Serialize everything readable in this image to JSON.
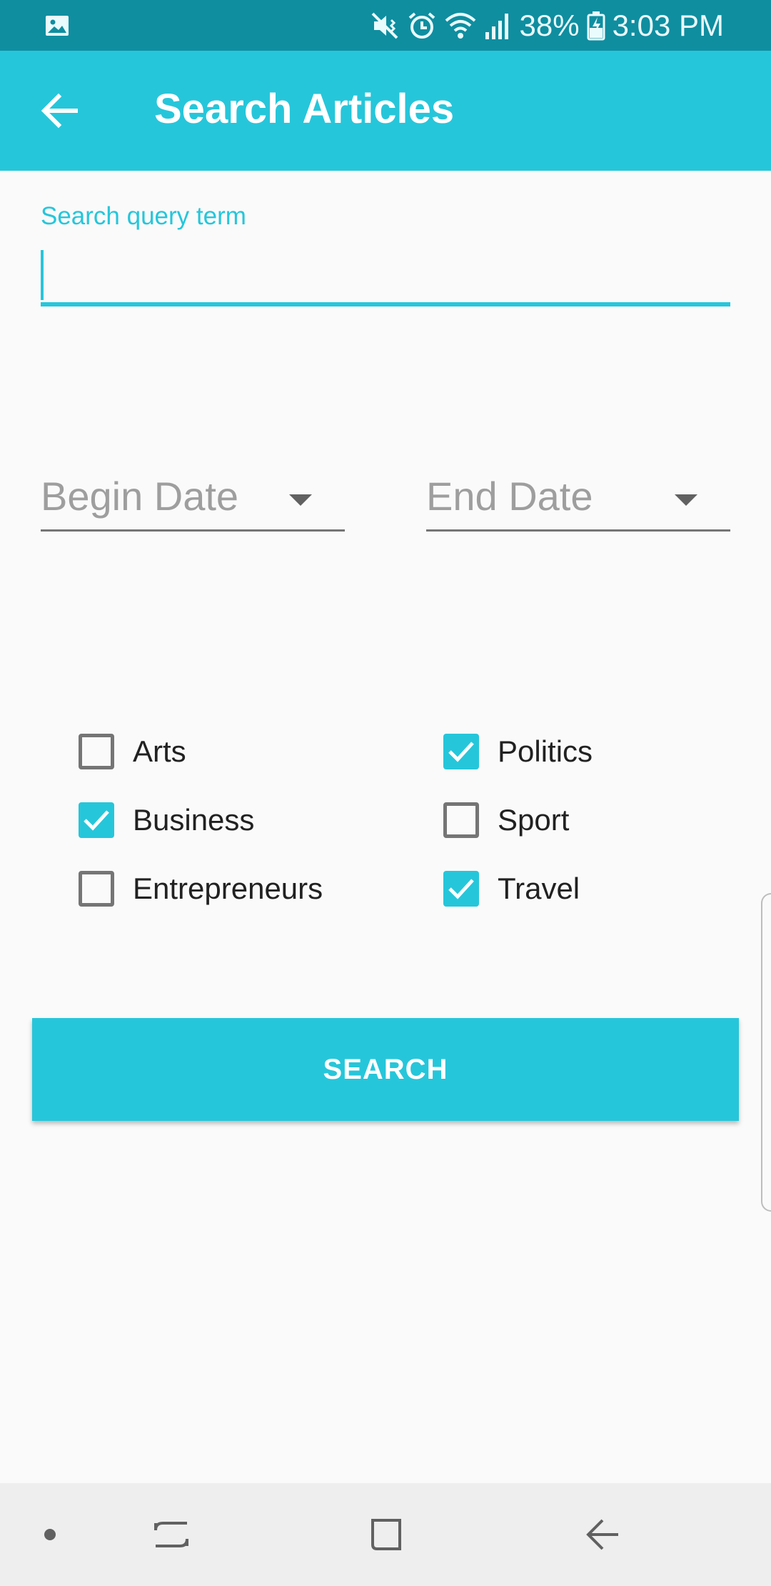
{
  "status_bar": {
    "battery": "38%",
    "time": "3:03 PM",
    "icons": [
      "gallery-icon",
      "mute-vibrate-icon",
      "alarm-icon",
      "wifi-icon",
      "signal-icon",
      "battery-charging-icon"
    ]
  },
  "app_bar": {
    "title": "Search Articles",
    "back_icon": "arrow-back-icon",
    "background": "#26c6da"
  },
  "search": {
    "label": "Search query term",
    "value": "",
    "accent": "#26c6da"
  },
  "dates": {
    "begin": "Begin Date",
    "end": "End Date"
  },
  "categories": [
    {
      "label": "Arts",
      "checked": false
    },
    {
      "label": "Politics",
      "checked": true
    },
    {
      "label": "Business",
      "checked": true
    },
    {
      "label": "Sport",
      "checked": false
    },
    {
      "label": "Entrepreneurs",
      "checked": false
    },
    {
      "label": "Travel",
      "checked": true
    }
  ],
  "search_button": {
    "label": "SEARCH"
  },
  "nav_bar": {
    "items": [
      "dot-icon",
      "recents-icon",
      "home-icon",
      "back-icon"
    ]
  },
  "colors": {
    "accent": "#26c6da",
    "status_bar": "#0f8ea0",
    "background": "#fafafa"
  }
}
